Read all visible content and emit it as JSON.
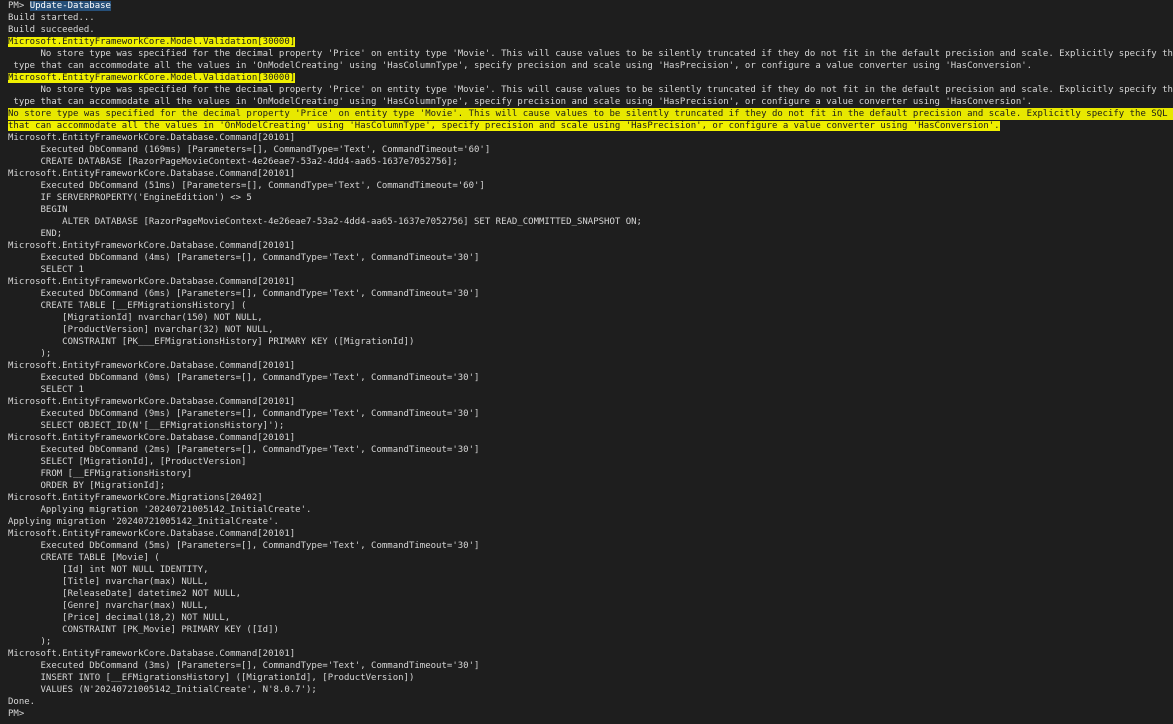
{
  "console": {
    "lines": [
      {
        "prefix": "PM> ",
        "text": "Update-Database",
        "style": "command"
      },
      {
        "text": "Build started..."
      },
      {
        "text": "Build succeeded."
      },
      {
        "text": "Microsoft.EntityFrameworkCore.Model.Validation[30000]",
        "style": "hl-tag"
      },
      {
        "text": "      No store type was specified for the decimal property 'Price' on entity type 'Movie'. This will cause values to be silently truncated if they do not fit in the default precision and scale. Explicitly specify the SQL server column"
      },
      {
        "text": " type that can accommodate all the values in 'OnModelCreating' using 'HasColumnType', specify precision and scale using 'HasPrecision', or configure a value converter using 'HasConversion'."
      },
      {
        "text": "Microsoft.EntityFrameworkCore.Model.Validation[30000]",
        "style": "hl-tag"
      },
      {
        "text": "      No store type was specified for the decimal property 'Price' on entity type 'Movie'. This will cause values to be silently truncated if they do not fit in the default precision and scale. Explicitly specify the SQL server column"
      },
      {
        "text": " type that can accommodate all the values in 'OnModelCreating' using 'HasColumnType', specify precision and scale using 'HasPrecision', or configure a value converter using 'HasConversion'."
      },
      {
        "text": "No store type was specified for the decimal property 'Price' on entity type 'Movie'. This will cause values to be silently truncated if they do not fit in the default precision and scale. Explicitly specify the SQL server column type",
        "style": "hl-line"
      },
      {
        "text": "that can accommodate all the values in 'OnModelCreating' using 'HasColumnType', specify precision and scale using 'HasPrecision', or configure a value converter using 'HasConversion'.",
        "style": "hl-tag"
      },
      {
        "text": "Microsoft.EntityFrameworkCore.Database.Command[20101]"
      },
      {
        "text": "      Executed DbCommand (169ms) [Parameters=[], CommandType='Text', CommandTimeout='60']"
      },
      {
        "text": "      CREATE DATABASE [RazorPageMovieContext-4e26eae7-53a2-4dd4-aa65-1637e7052756];"
      },
      {
        "text": "Microsoft.EntityFrameworkCore.Database.Command[20101]"
      },
      {
        "text": "      Executed DbCommand (51ms) [Parameters=[], CommandType='Text', CommandTimeout='60']"
      },
      {
        "text": "      IF SERVERPROPERTY('EngineEdition') <> 5"
      },
      {
        "text": "      BEGIN"
      },
      {
        "text": "          ALTER DATABASE [RazorPageMovieContext-4e26eae7-53a2-4dd4-aa65-1637e7052756] SET READ_COMMITTED_SNAPSHOT ON;"
      },
      {
        "text": "      END;"
      },
      {
        "text": "Microsoft.EntityFrameworkCore.Database.Command[20101]"
      },
      {
        "text": "      Executed DbCommand (4ms) [Parameters=[], CommandType='Text', CommandTimeout='30']"
      },
      {
        "text": "      SELECT 1"
      },
      {
        "text": "Microsoft.EntityFrameworkCore.Database.Command[20101]"
      },
      {
        "text": "      Executed DbCommand (6ms) [Parameters=[], CommandType='Text', CommandTimeout='30']"
      },
      {
        "text": "      CREATE TABLE [__EFMigrationsHistory] ("
      },
      {
        "text": "          [MigrationId] nvarchar(150) NOT NULL,"
      },
      {
        "text": "          [ProductVersion] nvarchar(32) NOT NULL,"
      },
      {
        "text": "          CONSTRAINT [PK___EFMigrationsHistory] PRIMARY KEY ([MigrationId])"
      },
      {
        "text": "      );"
      },
      {
        "text": "Microsoft.EntityFrameworkCore.Database.Command[20101]"
      },
      {
        "text": "      Executed DbCommand (0ms) [Parameters=[], CommandType='Text', CommandTimeout='30']"
      },
      {
        "text": "      SELECT 1"
      },
      {
        "text": "Microsoft.EntityFrameworkCore.Database.Command[20101]"
      },
      {
        "text": "      Executed DbCommand (9ms) [Parameters=[], CommandType='Text', CommandTimeout='30']"
      },
      {
        "text": "      SELECT OBJECT_ID(N'[__EFMigrationsHistory]');"
      },
      {
        "text": "Microsoft.EntityFrameworkCore.Database.Command[20101]"
      },
      {
        "text": "      Executed DbCommand (2ms) [Parameters=[], CommandType='Text', CommandTimeout='30']"
      },
      {
        "text": "      SELECT [MigrationId], [ProductVersion]"
      },
      {
        "text": "      FROM [__EFMigrationsHistory]"
      },
      {
        "text": "      ORDER BY [MigrationId];"
      },
      {
        "text": "Microsoft.EntityFrameworkCore.Migrations[20402]"
      },
      {
        "text": "      Applying migration '20240721005142_InitialCreate'."
      },
      {
        "text": "Applying migration '20240721005142_InitialCreate'."
      },
      {
        "text": "Microsoft.EntityFrameworkCore.Database.Command[20101]"
      },
      {
        "text": "      Executed DbCommand (5ms) [Parameters=[], CommandType='Text', CommandTimeout='30']"
      },
      {
        "text": "      CREATE TABLE [Movie] ("
      },
      {
        "text": "          [Id] int NOT NULL IDENTITY,"
      },
      {
        "text": "          [Title] nvarchar(max) NULL,"
      },
      {
        "text": "          [ReleaseDate] datetime2 NOT NULL,"
      },
      {
        "text": "          [Genre] nvarchar(max) NULL,"
      },
      {
        "text": "          [Price] decimal(18,2) NOT NULL,"
      },
      {
        "text": "          CONSTRAINT [PK_Movie] PRIMARY KEY ([Id])"
      },
      {
        "text": "      );"
      },
      {
        "text": "Microsoft.EntityFrameworkCore.Database.Command[20101]"
      },
      {
        "text": "      Executed DbCommand (3ms) [Parameters=[], CommandType='Text', CommandTimeout='30']"
      },
      {
        "text": "      INSERT INTO [__EFMigrationsHistory] ([MigrationId], [ProductVersion])"
      },
      {
        "text": "      VALUES (N'20240721005142_InitialCreate', N'8.0.7');"
      },
      {
        "text": "Done."
      },
      {
        "prefix": "PM>",
        "text": "",
        "style": "prompt"
      }
    ]
  }
}
